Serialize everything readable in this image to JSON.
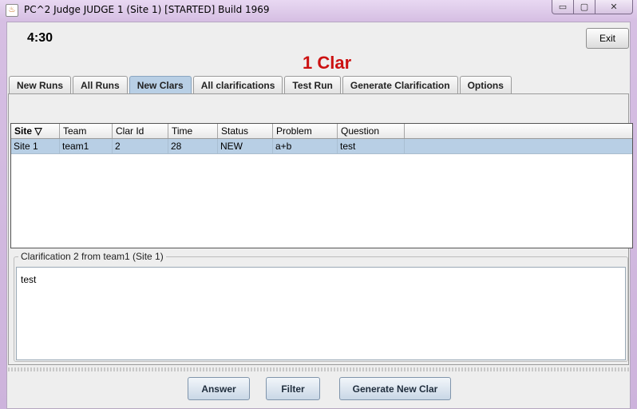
{
  "window": {
    "title": "PC^2 Judge JUDGE 1 (Site 1) [STARTED] Build 1969",
    "controls": {
      "minimize": "▭",
      "maximize": "▢",
      "close": "✕"
    }
  },
  "header": {
    "clock": "4:30",
    "exit_label": "Exit",
    "headline": "1 Clar",
    "headline_color": "#cc1111"
  },
  "tabs": [
    {
      "label": "New Runs",
      "active": false
    },
    {
      "label": "All Runs",
      "active": false
    },
    {
      "label": "New Clars",
      "active": true
    },
    {
      "label": "All clarifications",
      "active": false
    },
    {
      "label": "Test Run",
      "active": false
    },
    {
      "label": "Generate Clarification",
      "active": false
    },
    {
      "label": "Options",
      "active": false
    }
  ],
  "table": {
    "columns": [
      "Site",
      "Team",
      "Clar Id",
      "Time",
      "Status",
      "Problem",
      "Question",
      ""
    ],
    "sort_indicator": "▽",
    "rows": [
      [
        "Site 1",
        "team1",
        "2",
        "28",
        "NEW",
        "a+b",
        "test",
        ""
      ]
    ],
    "selected_color": "#b8cfe5"
  },
  "clarification": {
    "legend": "Clarification 2  from team1 (Site 1)",
    "text": "test"
  },
  "buttons": {
    "answer": "Answer",
    "filter": "Filter",
    "generate": "Generate New Clar"
  }
}
